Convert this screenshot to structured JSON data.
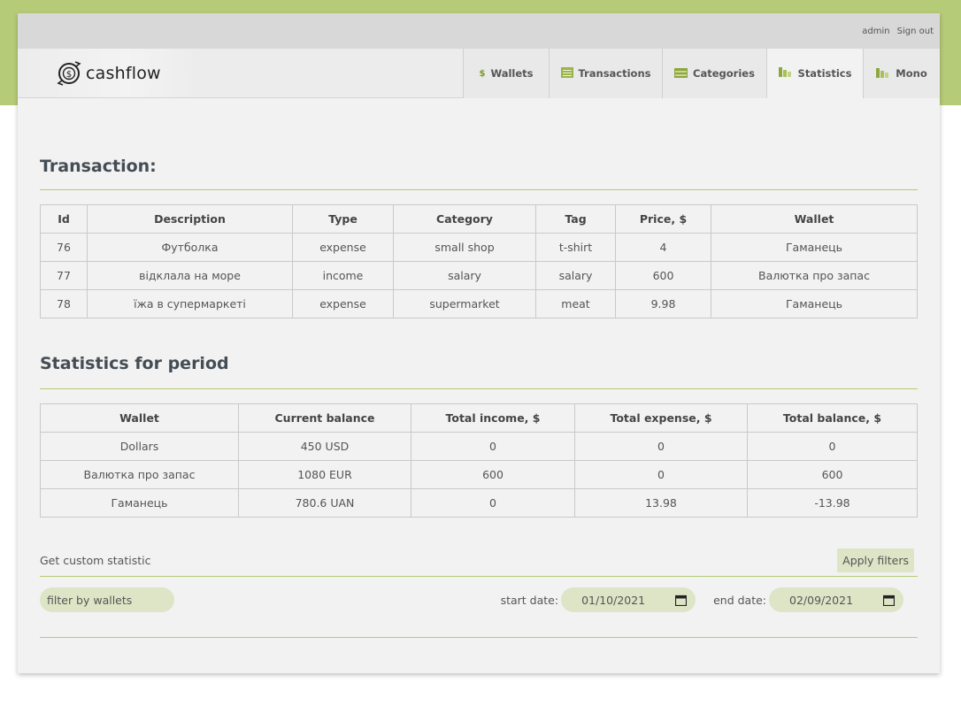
{
  "topbar": {
    "user": "admin",
    "signout": "Sign out"
  },
  "logo": {
    "text": "cashflow"
  },
  "nav": {
    "tabs": [
      {
        "label": "Wallets",
        "icon": "dollar-icon"
      },
      {
        "label": "Transactions",
        "icon": "list-icon"
      },
      {
        "label": "Categories",
        "icon": "folder-icon"
      },
      {
        "label": "Statistics",
        "icon": "bar-chart-icon"
      },
      {
        "label": "Mono",
        "icon": "bar-chart-icon"
      }
    ],
    "active": "Statistics"
  },
  "transaction": {
    "title": "Transaction:",
    "headers": [
      "Id",
      "Description",
      "Type",
      "Category",
      "Tag",
      "Price, $",
      "Wallet"
    ],
    "rows": [
      [
        "76",
        "Футболка",
        "expense",
        "small shop",
        "t-shirt",
        "4",
        "Гаманець"
      ],
      [
        "77",
        "відклала на море",
        "income",
        "salary",
        "salary",
        "600",
        "Валютка про запас"
      ],
      [
        "78",
        "їжа в супермаркеті",
        "expense",
        "supermarket",
        "meat",
        "9.98",
        "Гаманець"
      ]
    ]
  },
  "stats": {
    "title": "Statistics for period",
    "headers": [
      "Wallet",
      "Current balance",
      "Total income, $",
      "Total expense, $",
      "Total balance, $"
    ],
    "rows": [
      [
        "Dollars",
        "450 USD",
        "0",
        "0",
        "0"
      ],
      [
        "Валютка про запас",
        "1080 EUR",
        "600",
        "0",
        "600"
      ],
      [
        "Гаманець",
        "780.6 UAN",
        "0",
        "13.98",
        "-13.98"
      ]
    ]
  },
  "filters": {
    "label": "Get custom statistic",
    "apply": "Apply filters",
    "wallets_placeholder": "filter by wallets",
    "start_label": "start date:",
    "start_value": "01/10/2021",
    "end_label": "end date:",
    "end_value": "02/09/2021"
  },
  "colors": {
    "accent": "#b6cb78",
    "pill": "#dde5c6",
    "card": "#f2f2f2"
  }
}
